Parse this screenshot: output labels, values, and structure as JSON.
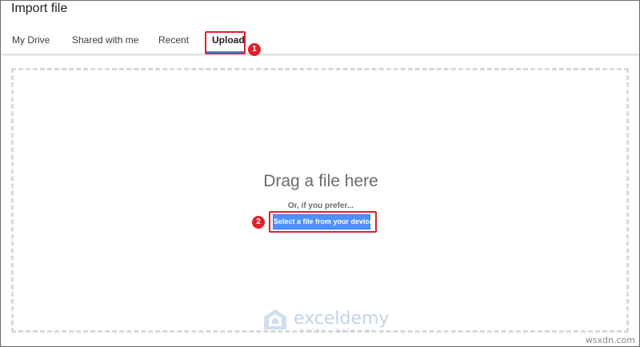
{
  "dialog": {
    "title": "Import file"
  },
  "tabs": [
    {
      "label": "My Drive",
      "active": false
    },
    {
      "label": "Shared with me",
      "active": false
    },
    {
      "label": "Recent",
      "active": false
    },
    {
      "label": "Upload",
      "active": true
    }
  ],
  "annotations": {
    "step1": "1",
    "step2": "2",
    "highlight_color": "#e0202b"
  },
  "upload": {
    "drag_text": "Drag a file here",
    "prefer_text": "Or, if you prefer...",
    "select_button_label": "Select a file from your device",
    "button_color": "#4d90fe"
  },
  "watermark": {
    "name": "exceldemy",
    "tagline": "EXCEL · DATA · BI"
  },
  "site_mark": "wsxdn.com"
}
